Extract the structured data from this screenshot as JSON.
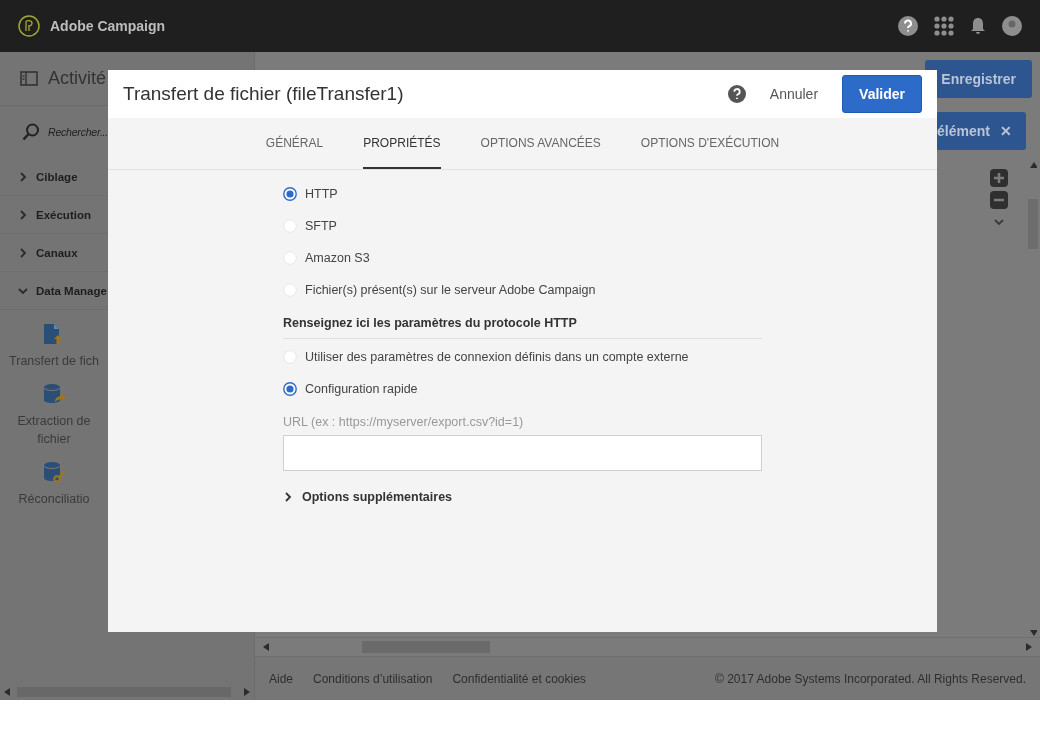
{
  "header": {
    "product": "Adobe Campaign"
  },
  "toolbar": {
    "title": "Activité",
    "save_button": "Enregistrer",
    "element_button": "élément",
    "element_close": "✕"
  },
  "sidebar": {
    "search_placeholder": "Rechercher...",
    "categories": [
      {
        "label": "Ciblage",
        "expanded": false
      },
      {
        "label": "Exécution",
        "expanded": false
      },
      {
        "label": "Canaux",
        "expanded": false
      },
      {
        "label": "Data Manage",
        "expanded": true,
        "children": [
          {
            "label": "Transfert de fich",
            "kind": "file-upload"
          },
          {
            "label": "Extraction de fichier",
            "kind": "db-export"
          },
          {
            "label": "Réconciliatio",
            "kind": "db-key"
          }
        ]
      }
    ]
  },
  "footer": {
    "links": [
      "Aide",
      "Conditions d’utilisation",
      "Confidentialité et cookies"
    ],
    "copyright": "© 2017 Adobe Systems Incorporated. All Rights Reserved."
  },
  "dialog": {
    "title": "Transfert de fichier (fileTransfer1)",
    "cancel": "Annuler",
    "confirm": "Valider",
    "tabs": [
      {
        "label": "GÉNÉRAL",
        "selected": false
      },
      {
        "label": "PROPRIÉTÉS",
        "selected": true
      },
      {
        "label": "OPTIONS AVANCÉES",
        "selected": false
      },
      {
        "label": "OPTIONS D'EXÉCUTION",
        "selected": false
      }
    ],
    "protocols": [
      {
        "label": "HTTP",
        "selected": true
      },
      {
        "label": "SFTP",
        "selected": false
      },
      {
        "label": "Amazon S3",
        "selected": false
      },
      {
        "label": "Fichier(s) présent(s) sur le serveur Adobe Campaign",
        "selected": false
      }
    ],
    "section_heading": "Renseignez ici les paramètres du protocole HTTP",
    "connection": [
      {
        "label": "Utiliser des paramètres de connexion définis dans un compte externe",
        "selected": false
      },
      {
        "label": "Configuration rapide",
        "selected": true
      }
    ],
    "url_field": {
      "label": "URL (ex : https://myserver/export.csv?id=1)"
    },
    "more_options": {
      "label": "Options supplémentaires",
      "expanded": false
    }
  }
}
